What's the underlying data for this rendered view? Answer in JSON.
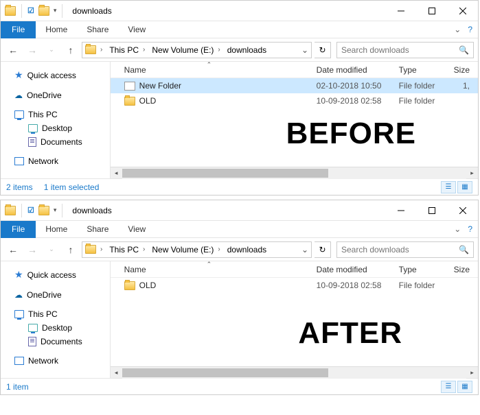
{
  "before": {
    "title": "downloads",
    "menubar": {
      "file": "File",
      "home": "Home",
      "share": "Share",
      "view": "View"
    },
    "breadcrumb": [
      "This PC",
      "New Volume (E:)",
      "downloads"
    ],
    "search_placeholder": "Search downloads",
    "columns": {
      "name": "Name",
      "date": "Date modified",
      "type": "Type",
      "size": "Size"
    },
    "sidebar": {
      "quick_access": "Quick access",
      "onedrive": "OneDrive",
      "this_pc": "This PC",
      "desktop": "Desktop",
      "documents": "Documents",
      "network": "Network"
    },
    "rows": [
      {
        "name": "New Folder",
        "date": "02-10-2018 10:50",
        "type": "File folder",
        "size": "1,",
        "selected": true,
        "renaming": true
      },
      {
        "name": "OLD",
        "date": "10-09-2018 02:58",
        "type": "File folder",
        "size": "",
        "selected": false,
        "renaming": false
      }
    ],
    "overlay": "BEFORE",
    "status": {
      "count": "2 items",
      "selection": "1 item selected"
    }
  },
  "after": {
    "title": "downloads",
    "menubar": {
      "file": "File",
      "home": "Home",
      "share": "Share",
      "view": "View"
    },
    "breadcrumb": [
      "This PC",
      "New Volume (E:)",
      "downloads"
    ],
    "search_placeholder": "Search downloads",
    "columns": {
      "name": "Name",
      "date": "Date modified",
      "type": "Type",
      "size": "Size"
    },
    "sidebar": {
      "quick_access": "Quick access",
      "onedrive": "OneDrive",
      "this_pc": "This PC",
      "desktop": "Desktop",
      "documents": "Documents",
      "network": "Network"
    },
    "rows": [
      {
        "name": "OLD",
        "date": "10-09-2018 02:58",
        "type": "File folder",
        "size": "",
        "selected": false,
        "renaming": false
      }
    ],
    "overlay": "AFTER",
    "status": {
      "count": "1 item",
      "selection": ""
    }
  }
}
